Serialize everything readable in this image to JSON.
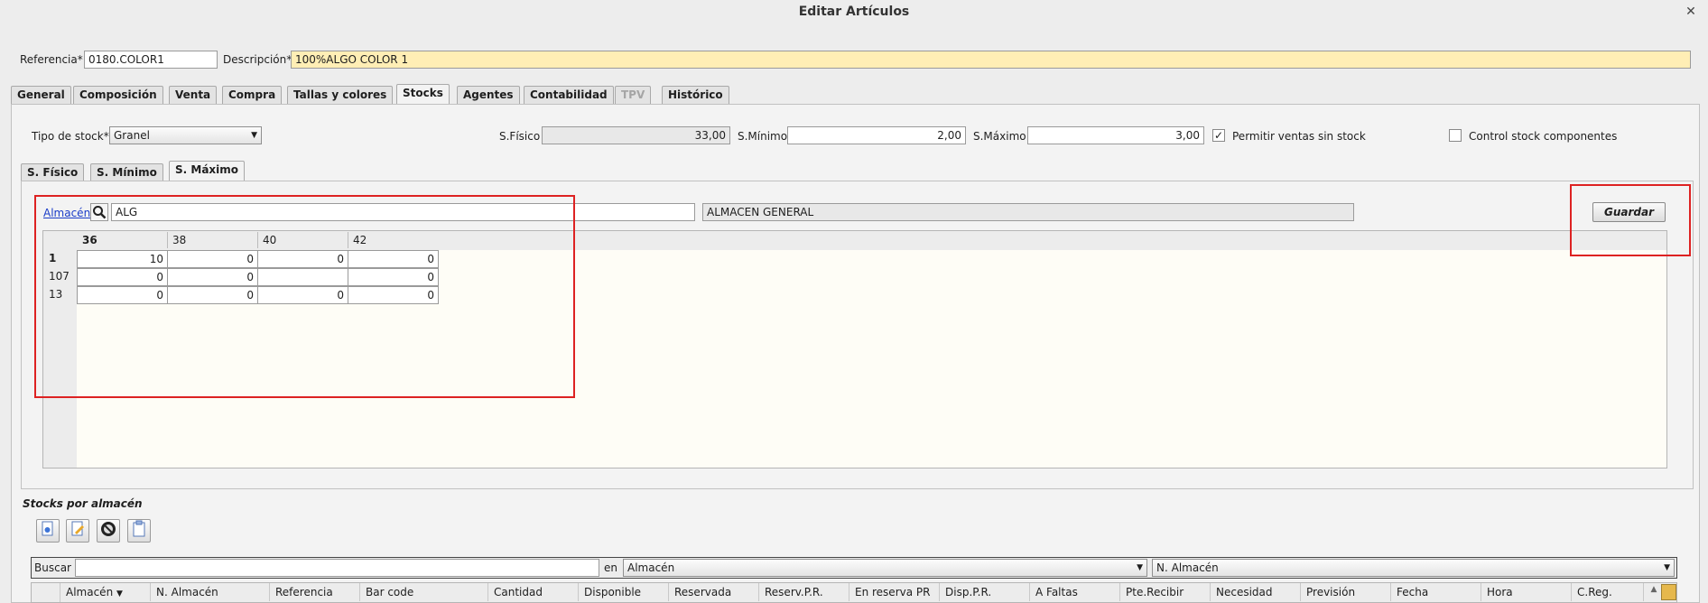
{
  "window": {
    "title": "Editar Artículos",
    "close_glyph": "✕"
  },
  "header": {
    "referencia_label": "Referencia*",
    "referencia_value": "0180.COLOR1",
    "descripcion_label": "Descripción*",
    "descripcion_value": "100%ALGO COLOR 1"
  },
  "main_tabs": [
    "General",
    "Composición",
    "Venta",
    "Compra",
    "Tallas y colores",
    "Stocks",
    "Agentes",
    "Contabilidad",
    "TPV",
    "Histórico"
  ],
  "main_tabs_active": "Stocks",
  "main_tabs_disabled": [
    "TPV"
  ],
  "stocks": {
    "tipo_label": "Tipo de stock*",
    "tipo_value": "Granel",
    "sfisico_label": "S.Físico",
    "sfisico_value": "33,00",
    "sminimo_label": "S.Mínimo",
    "sminimo_value": "2,00",
    "smaximo_label": "S.Máximo",
    "smaximo_value": "3,00",
    "permitir_label": "Permitir ventas sin stock",
    "permitir_checked": true,
    "control_label": "Control stock componentes",
    "control_checked": false,
    "sub_tabs": [
      "S. Físico",
      "S. Mínimo",
      "S. Máximo"
    ],
    "sub_tabs_active": "S. Máximo",
    "almacen_link": "Almacén",
    "almacen_code": "ALG",
    "almacen_name": "ALMACEN GENERAL",
    "guardar_label": "Guardar",
    "matrix": {
      "columns": [
        "36",
        "38",
        "40",
        "42"
      ],
      "rows": [
        {
          "label": "1",
          "values": [
            "10",
            "0",
            "0",
            "0"
          ]
        },
        {
          "label": "107",
          "values": [
            "0",
            "0",
            "",
            "0"
          ]
        },
        {
          "label": "13",
          "values": [
            "0",
            "0",
            "0",
            "0"
          ]
        }
      ]
    }
  },
  "por_almacen": {
    "section_title": "Stocks por almacén",
    "toolbar_icons": [
      "new-document-icon",
      "edit-document-icon",
      "delete-icon",
      "clipboard-icon"
    ],
    "buscar_label": "Buscar",
    "buscar_value": "",
    "en_label": "en",
    "en_field_value": "Almacén",
    "order_field_value": "N. Almacén",
    "table_columns": [
      "Almacén",
      "N. Almacén",
      "Referencia",
      "Bar code",
      "Cantidad",
      "Disponible",
      "Reservada",
      "Reserv.P.R.",
      "En reserva PR",
      "Disp.P.R.",
      "A Faltas",
      "Pte.Recibir",
      "Necesidad",
      "Previsión",
      "Fecha",
      "Hora",
      "C.Reg."
    ]
  },
  "colors": {
    "highlight_red": "#dd2222",
    "description_bg": "#ffeeb5",
    "grid_bg": "#fefdf6",
    "link": "#1a3cc8"
  }
}
